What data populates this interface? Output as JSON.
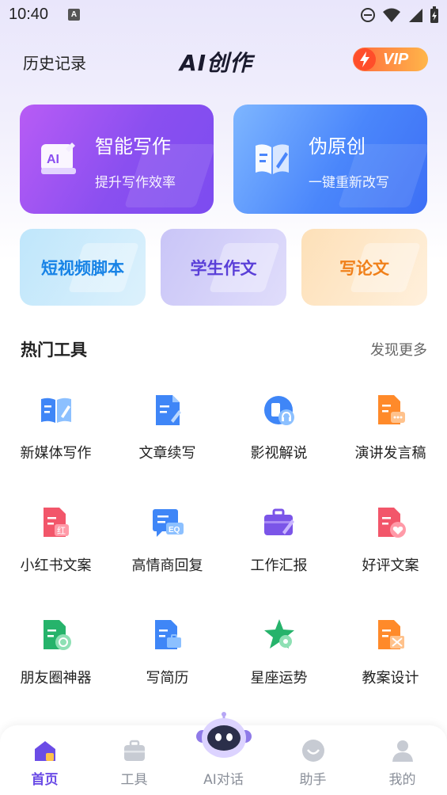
{
  "status_bar": {
    "time": "10:40",
    "notif_letter": "A"
  },
  "header": {
    "history_label": "历史记录",
    "app_title": "AI创作",
    "vip_label": "VIP"
  },
  "feature_cards": [
    {
      "title": "智能写作",
      "subtitle": "提升写作效率",
      "icon": "ai-writing-icon",
      "color": "#8a4ff0"
    },
    {
      "title": "伪原创",
      "subtitle": "一键重新改写",
      "icon": "book-edit-icon",
      "color": "#4a86fb"
    }
  ],
  "quick_cards": [
    {
      "label": "短视频脚本",
      "color": "#1783e6"
    },
    {
      "label": "学生作文",
      "color": "#5a3fd8"
    },
    {
      "label": "写论文",
      "color": "#f0801a"
    }
  ],
  "hot_tools": {
    "title": "热门工具",
    "more_label": "发现更多",
    "items": [
      {
        "label": "新媒体写作",
        "icon": "open-book-pen-icon"
      },
      {
        "label": "文章续写",
        "icon": "document-pen-icon"
      },
      {
        "label": "影视解说",
        "icon": "headset-icon"
      },
      {
        "label": "演讲发言稿",
        "icon": "speech-document-icon"
      },
      {
        "label": "小红书文案",
        "icon": "red-note-icon"
      },
      {
        "label": "高情商回复",
        "icon": "eq-chat-icon"
      },
      {
        "label": "工作汇报",
        "icon": "briefcase-pen-icon"
      },
      {
        "label": "好评文案",
        "icon": "heart-document-icon"
      },
      {
        "label": "朋友圈神器",
        "icon": "moments-document-icon"
      },
      {
        "label": "写简历",
        "icon": "resume-document-icon"
      },
      {
        "label": "星座运势",
        "icon": "star-clover-icon"
      },
      {
        "label": "教案设计",
        "icon": "lesson-plan-icon"
      }
    ]
  },
  "bottom_nav": [
    {
      "label": "首页",
      "icon": "home-icon",
      "active": true
    },
    {
      "label": "工具",
      "icon": "toolbox-icon",
      "active": false
    },
    {
      "label": "AI对话",
      "icon": "robot-icon",
      "active": false
    },
    {
      "label": "助手",
      "icon": "assistant-icon",
      "active": false
    },
    {
      "label": "我的",
      "icon": "profile-icon",
      "active": false
    }
  ],
  "colors": {
    "accent": "#6b4ce6",
    "vip_start": "#ff6a3d",
    "vip_end": "#ffb64a"
  }
}
